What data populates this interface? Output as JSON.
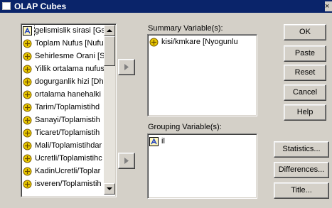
{
  "window": {
    "title": "OLAP Cubes",
    "close_glyph": "×"
  },
  "variables": [
    {
      "label": "gelismislik sirasi [Gs",
      "icon": "nominal-icon"
    },
    {
      "label": "Toplam Nufus [Nufu",
      "icon": "scale-icon"
    },
    {
      "label": "Sehirlesme Orani [S",
      "icon": "scale-icon"
    },
    {
      "label": "Yillik ortalama nufus",
      "icon": "scale-icon"
    },
    {
      "label": "dogurganlik hizi [Dh",
      "icon": "scale-icon"
    },
    {
      "label": "ortalama hanehalki",
      "icon": "scale-icon"
    },
    {
      "label": "Tarim/Toplamistihd",
      "icon": "scale-icon"
    },
    {
      "label": "Sanayi/Toplamistih",
      "icon": "scale-icon"
    },
    {
      "label": "Ticaret/Toplamistih",
      "icon": "scale-icon"
    },
    {
      "label": "Mali/Toplamistihdar",
      "icon": "scale-icon"
    },
    {
      "label": "Ucretli/Toplamistihc",
      "icon": "scale-icon"
    },
    {
      "label": "KadinUcretli/Toplar",
      "icon": "scale-icon"
    },
    {
      "label": "isveren/Toplamistih",
      "icon": "scale-icon"
    }
  ],
  "summary": {
    "label": "Summary Variable(s):",
    "items": [
      {
        "label": "kisi/kmkare [Nyogunlu",
        "icon": "scale-icon"
      }
    ]
  },
  "grouping": {
    "label": "Grouping Variable(s):",
    "items": [
      {
        "label": "il",
        "icon": "nominal-icon"
      }
    ]
  },
  "buttons": {
    "ok": "OK",
    "paste": "Paste",
    "reset": "Reset",
    "cancel": "Cancel",
    "help": "Help",
    "statistics": "Statistics...",
    "differences": "Differences...",
    "title": "Title..."
  },
  "colors": {
    "titlebar": "#0a246a",
    "dialog": "#d4d0c8",
    "scale_icon": "#e8c800",
    "nominal_icon": "#2040c0"
  }
}
